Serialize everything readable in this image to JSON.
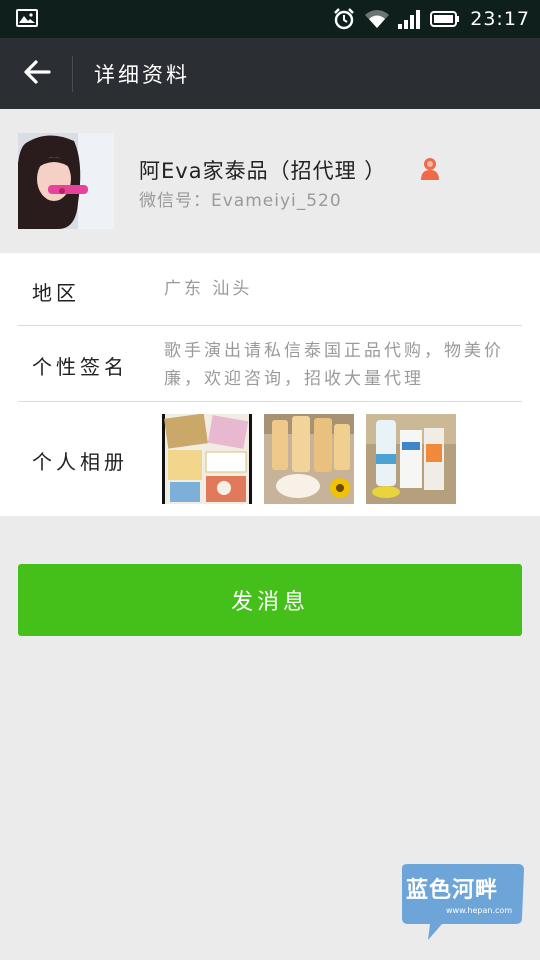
{
  "status_bar": {
    "time": "23:17",
    "icons": [
      "gallery-icon",
      "alarm-icon",
      "wifi-icon",
      "signal-icon",
      "battery-icon"
    ]
  },
  "app_bar": {
    "title": "详细资料",
    "back_icon": "back-arrow-icon"
  },
  "profile": {
    "name": "阿Eva家泰品（招代理 ）",
    "wechat_id": "微信号：Evameiyi_520",
    "gender_icon": "female-icon"
  },
  "info_rows": {
    "region": {
      "label": "地区",
      "value": "广东  汕头"
    },
    "signature": {
      "label": "个性签名",
      "value": "歌手演出请私信泰国正品代购，物美价廉，欢迎咨询，招收大量代理"
    },
    "album": {
      "label": "个人相册",
      "photo_count": 3
    }
  },
  "actions": {
    "send_message": "发消息"
  },
  "watermark": {
    "brand": "蓝色河畔",
    "site": "www.hepan.com"
  },
  "colors": {
    "status_bar_bg": "#0f1f1b",
    "app_bar_bg": "#2b2f33",
    "page_bg": "#ebebeb",
    "accent_green": "#45c01a",
    "gender_orange": "#f06a4a"
  }
}
